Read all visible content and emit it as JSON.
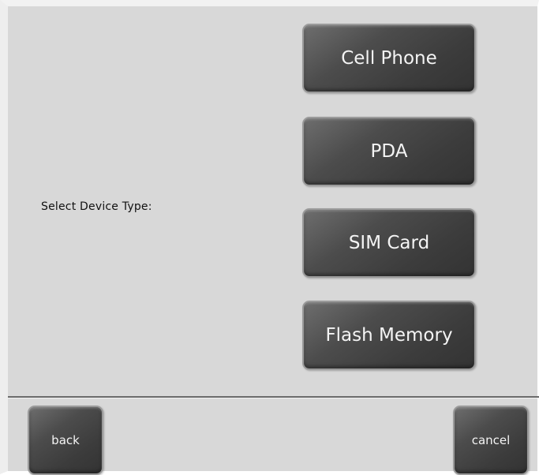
{
  "prompt": {
    "label": "Select Device Type:"
  },
  "device_types": [
    {
      "label": "Cell Phone"
    },
    {
      "label": "PDA"
    },
    {
      "label": "SIM Card"
    },
    {
      "label": "Flash Memory"
    }
  ],
  "nav": {
    "back_label": "back",
    "cancel_label": "cancel"
  },
  "colors": {
    "background": "#d8d8d8",
    "button": "#444444",
    "button_text": "#f4f4f4",
    "text": "#111111"
  }
}
